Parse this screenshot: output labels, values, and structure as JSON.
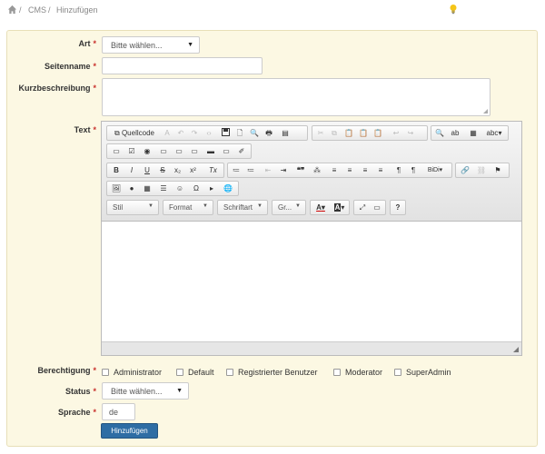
{
  "breadcrumb": {
    "items": [
      "CMS",
      "Hinzufügen"
    ]
  },
  "form": {
    "art": {
      "label": "Art",
      "value": "Bitte wählen..."
    },
    "seitenname": {
      "label": "Seitenname",
      "value": ""
    },
    "kurzbeschreibung": {
      "label": "Kurzbeschreibung",
      "value": ""
    },
    "text": {
      "label": "Text"
    },
    "berechtigung": {
      "label": "Berechtigung",
      "options": [
        "Administrator",
        "Default",
        "Registrierter Benutzer",
        "Moderator",
        "SuperAdmin"
      ]
    },
    "status": {
      "label": "Status",
      "value": "Bitte wählen..."
    },
    "sprache": {
      "label": "Sprache",
      "value": "de"
    },
    "required_marker": "*",
    "submit_label": "Hinzufügen"
  },
  "editor": {
    "source_label": "Quellcode",
    "row1": [
      "A",
      "↶",
      "↷",
      "‹›",
      "",
      "🗋",
      "🔍",
      "🖶",
      "▤",
      "✂",
      "⧉",
      "📋",
      "📋",
      "📋",
      "↩",
      "↪",
      "🔍",
      "ab",
      "▦",
      "abc"
    ],
    "row2": [
      "▭",
      "☑",
      "◉",
      "▭",
      "▭",
      "▭",
      "▬",
      "▭",
      "✐"
    ],
    "row3": [
      "B",
      "I",
      "U",
      "S",
      "x₂",
      "x²",
      "Tx",
      "≔",
      "≔",
      "⇤",
      "⇥",
      "❝❞",
      "⁂",
      "≡",
      "≡",
      "≡",
      "≡",
      "¶",
      "¶",
      "BiDi",
      "🔗",
      "⛓",
      "⚑"
    ],
    "row4": [
      "🖼",
      "●",
      "▦",
      "☰",
      "☺",
      "Ω",
      "▸",
      "🌐"
    ],
    "combos": {
      "style": "Stil",
      "format": "Format",
      "font": "Schriftart",
      "size": "Gr..."
    },
    "row5": [
      "A",
      "A",
      "⤢",
      "▭",
      "?"
    ]
  },
  "colors": {
    "panel_bg": "#fcf8e3",
    "required": "#c9302c",
    "primary": "#2e6da4"
  }
}
